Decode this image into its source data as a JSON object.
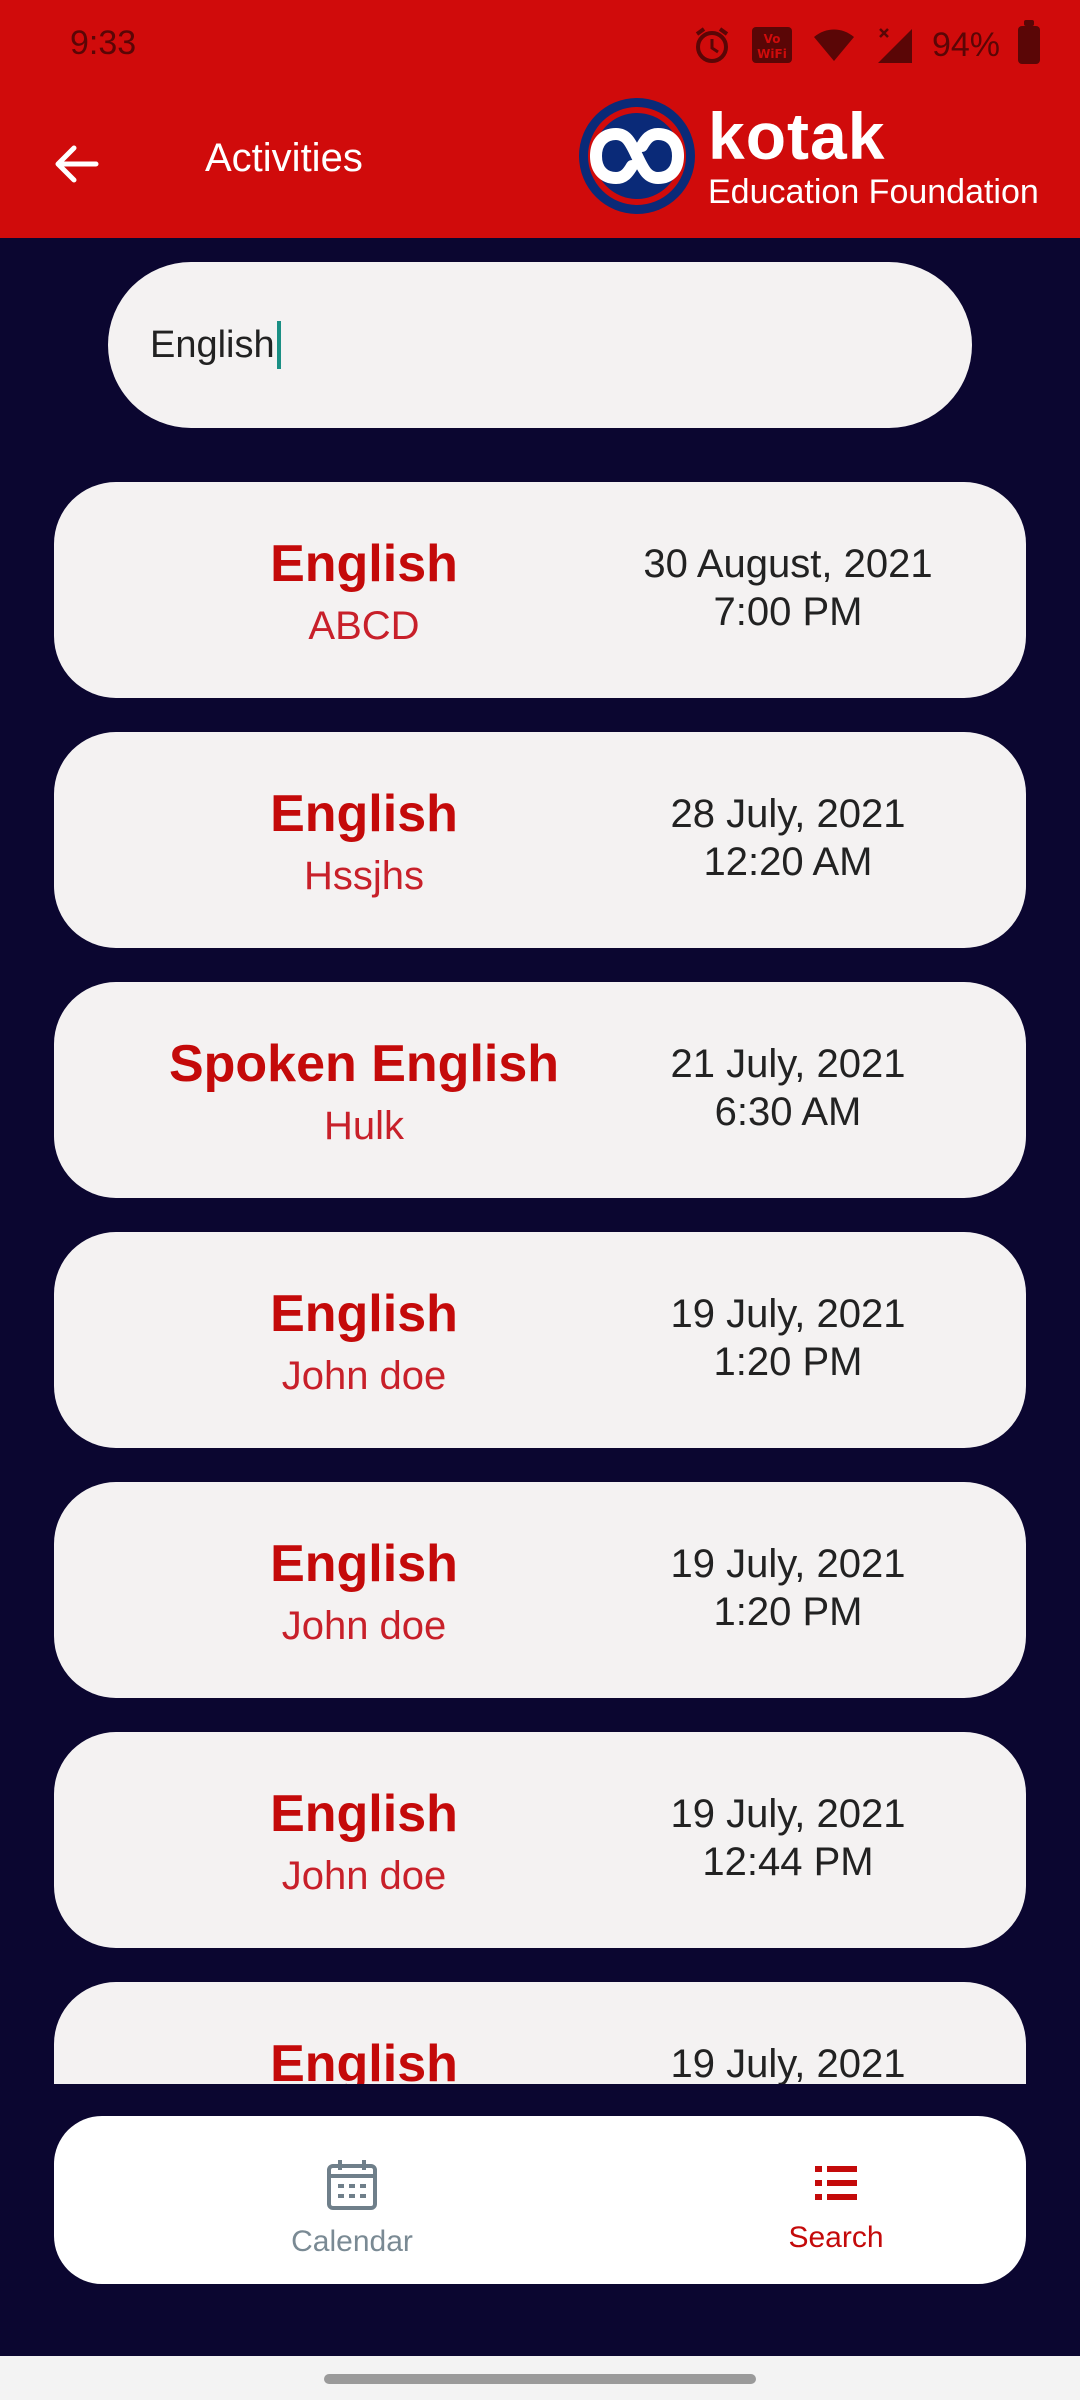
{
  "status": {
    "time": "9:33",
    "battery": "94%",
    "volte_wifi": "Vo\nWiFi"
  },
  "header": {
    "title": "Activities",
    "brand_word": "kotak",
    "brand_sub": "Education Foundation"
  },
  "search": {
    "value": "English"
  },
  "activities": [
    {
      "name": "English",
      "person": "ABCD",
      "date": "30 August, 2021",
      "time": "7:00 PM"
    },
    {
      "name": "English",
      "person": "Hssjhs",
      "date": "28 July, 2021",
      "time": "12:20 AM"
    },
    {
      "name": "Spoken English",
      "person": "Hulk",
      "date": "21 July, 2021",
      "time": "6:30 AM"
    },
    {
      "name": "English",
      "person": "John doe",
      "date": "19 July, 2021",
      "time": "1:20 PM"
    },
    {
      "name": "English",
      "person": "John doe",
      "date": "19 July, 2021",
      "time": "1:20 PM"
    },
    {
      "name": "English",
      "person": "John doe",
      "date": "19 July, 2021",
      "time": "12:44 PM"
    },
    {
      "name": "English",
      "person": "",
      "date": "19 July, 2021",
      "time": ""
    }
  ],
  "nav": {
    "calendar_label": "Calendar",
    "search_label": "Search"
  },
  "colors": {
    "header_red": "#d00b0b",
    "background_navy": "#0b0630",
    "accent_red": "#c40a0a",
    "inactive_gray": "#7a8a94"
  }
}
